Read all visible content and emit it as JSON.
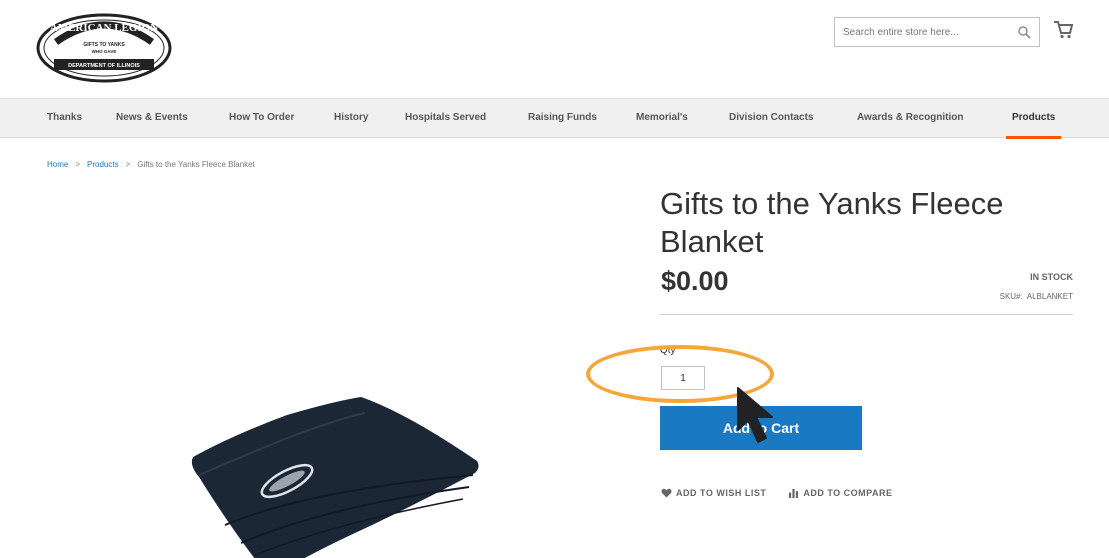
{
  "header": {
    "logo": {
      "line1": "AMERICAN LEGION",
      "line2": "GIFTS TO YANKS",
      "line3": "WHO GAVE",
      "line4": "DEPARTMENT OF ILLINOIS"
    },
    "search_placeholder": "Search entire store here...",
    "icons": {
      "search": "search-icon",
      "cart": "cart-icon"
    }
  },
  "nav": {
    "items": [
      {
        "label": "Thanks"
      },
      {
        "label": "News & Events"
      },
      {
        "label": "How To Order"
      },
      {
        "label": "History"
      },
      {
        "label": "Hospitals Served"
      },
      {
        "label": "Raising Funds"
      },
      {
        "label": "Memorial's"
      },
      {
        "label": "Division Contacts"
      },
      {
        "label": "Awards & Recognition"
      },
      {
        "label": "Products"
      }
    ],
    "active": "Products",
    "accent_color": "#ff5501"
  },
  "breadcrumb": {
    "home": "Home",
    "sep": ">",
    "products": "Products",
    "current": "Gifts to the Yanks Fleece Blanket"
  },
  "product": {
    "title": "Gifts to the Yanks Fleece Blanket",
    "price": "$0.00",
    "stock": "IN STOCK",
    "sku_label": "SKU#:",
    "sku": "ALBLANKET",
    "qty_label": "Qty",
    "qty_value": "1",
    "add_to_cart": "Add to Cart",
    "wishlist": "ADD TO WISH LIST",
    "compare": "ADD TO COMPARE",
    "button_color": "#1979c3",
    "highlight_color": "#f6a73b"
  }
}
